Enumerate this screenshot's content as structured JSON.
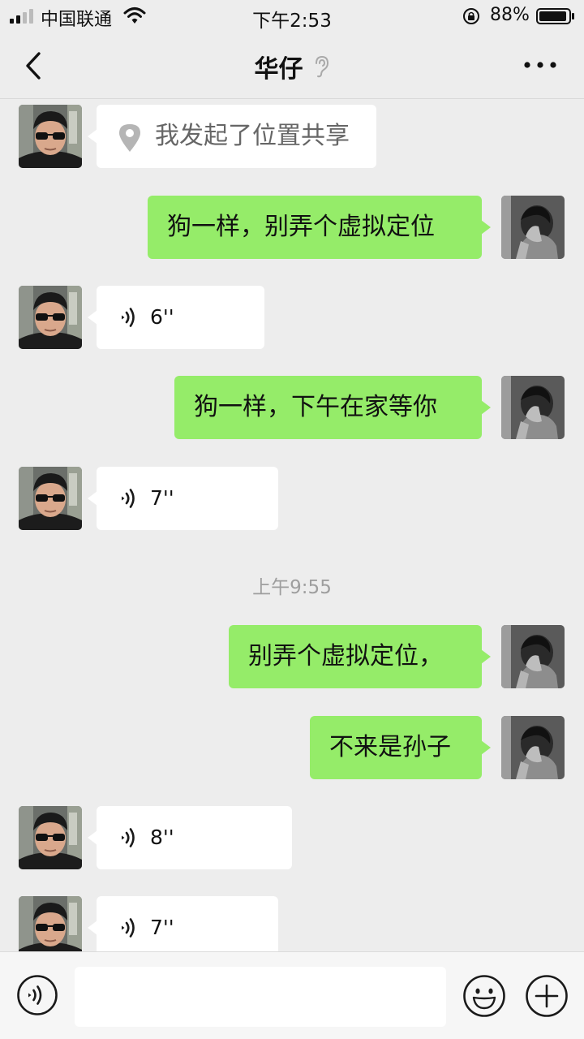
{
  "status_bar": {
    "carrier": "中国联通",
    "time": "下午2:53",
    "battery": "88%",
    "icons": [
      "signal-icon",
      "wifi-icon",
      "orientation-lock-icon",
      "battery-icon"
    ]
  },
  "header": {
    "title": "华仔",
    "icons": [
      "back-arrow-icon",
      "ear-icon",
      "more-icon"
    ]
  },
  "messages": [
    {
      "side": "left",
      "type": "location",
      "text": "我发起了位置共享"
    },
    {
      "side": "right",
      "type": "text",
      "text": "狗一样，别弄个虚拟定位"
    },
    {
      "side": "left",
      "type": "voice",
      "duration": "6''"
    },
    {
      "side": "right",
      "type": "text",
      "text": "狗一样，下午在家等你"
    },
    {
      "side": "left",
      "type": "voice",
      "duration": "7''"
    },
    {
      "type": "timestamp",
      "text": "上午9:55"
    },
    {
      "side": "right",
      "type": "text",
      "text": "别弄个虚拟定位，"
    },
    {
      "side": "right",
      "type": "text",
      "text": "不来是孙子"
    },
    {
      "side": "left",
      "type": "voice",
      "duration": "8''"
    },
    {
      "side": "left",
      "type": "voice",
      "duration": "7''"
    }
  ],
  "input_bar": {
    "placeholder": "",
    "icons": [
      "voice-mode-icon",
      "emoji-icon",
      "plus-icon"
    ]
  },
  "colors": {
    "background": "#ededed",
    "sent_bubble": "#95ec69",
    "received_bubble": "#ffffff",
    "timestamp": "#9e9e9e"
  }
}
